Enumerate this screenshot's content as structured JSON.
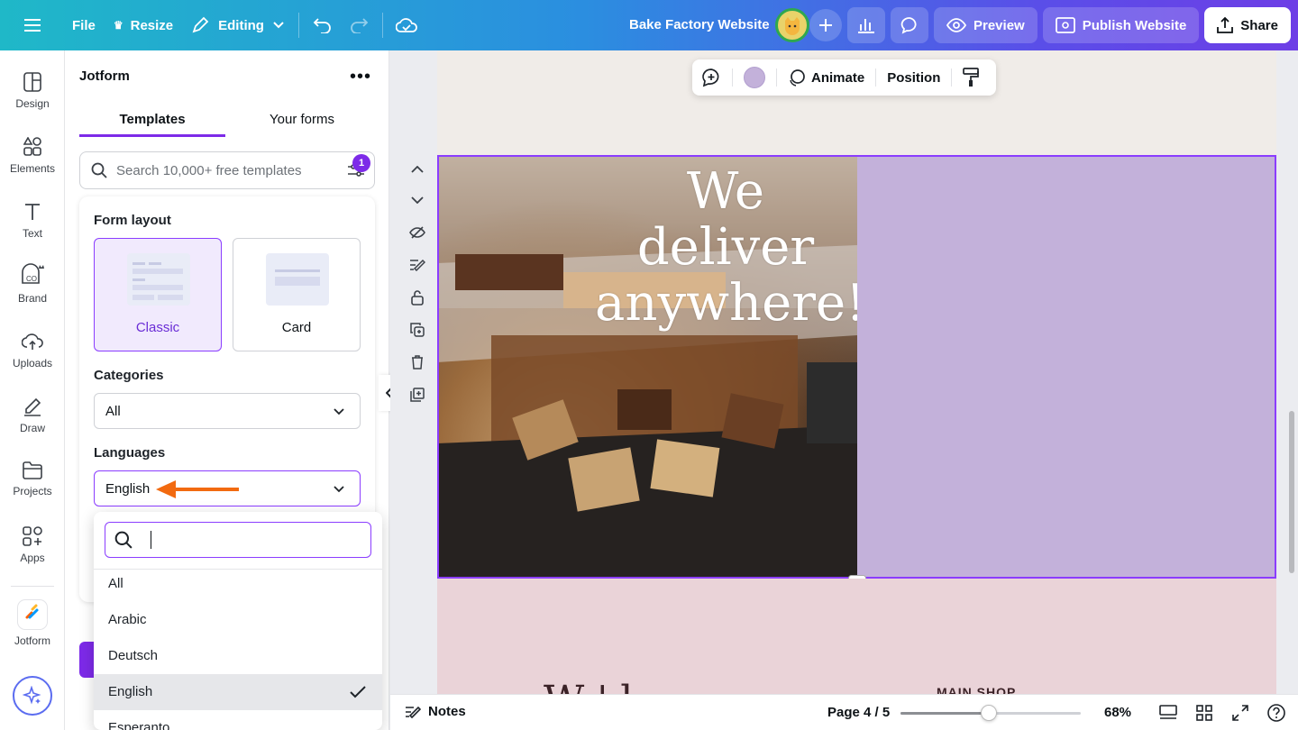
{
  "topbar": {
    "file": "File",
    "resize": "Resize",
    "editing": "Editing",
    "title": "Bake Factory Website",
    "preview": "Preview",
    "publish": "Publish Website",
    "share": "Share"
  },
  "rail": {
    "items": [
      {
        "label": "Design",
        "icon": "design-icon"
      },
      {
        "label": "Elements",
        "icon": "elements-icon"
      },
      {
        "label": "Text",
        "icon": "text-icon"
      },
      {
        "label": "Brand",
        "icon": "brand-icon"
      },
      {
        "label": "Uploads",
        "icon": "uploads-icon"
      },
      {
        "label": "Draw",
        "icon": "draw-icon"
      },
      {
        "label": "Projects",
        "icon": "projects-icon"
      },
      {
        "label": "Apps",
        "icon": "apps-icon"
      }
    ],
    "jotform": "Jotform"
  },
  "panel": {
    "title": "Jotform",
    "tabs": [
      "Templates",
      "Your forms"
    ],
    "active_tab": "Templates",
    "search_placeholder": "Search 10,000+ free templates",
    "filter_count": "1",
    "form_layout_label": "Form layout",
    "layouts": [
      {
        "name": "Classic",
        "selected": true
      },
      {
        "name": "Card",
        "selected": false
      }
    ],
    "categories_label": "Categories",
    "categories_value": "All",
    "languages_label": "Languages",
    "languages_value": "English"
  },
  "dropdown": {
    "search_value": "",
    "options": [
      "All",
      "Arabic",
      "Deutsch",
      "English",
      "Esperanto"
    ],
    "selected": "English"
  },
  "canvas": {
    "context_toolbar": {
      "animate": "Animate",
      "position": "Position",
      "color": "#c3b1da"
    },
    "headline": "We deliver anywhere!",
    "bottom_script": "W  ' l",
    "bottom_shop": "MAIN SHOP",
    "accent_color": "#8b3dff"
  },
  "footer": {
    "notes": "Notes",
    "page": "Page 4 / 5",
    "zoom": "68%",
    "zoom_level": 0.49
  }
}
